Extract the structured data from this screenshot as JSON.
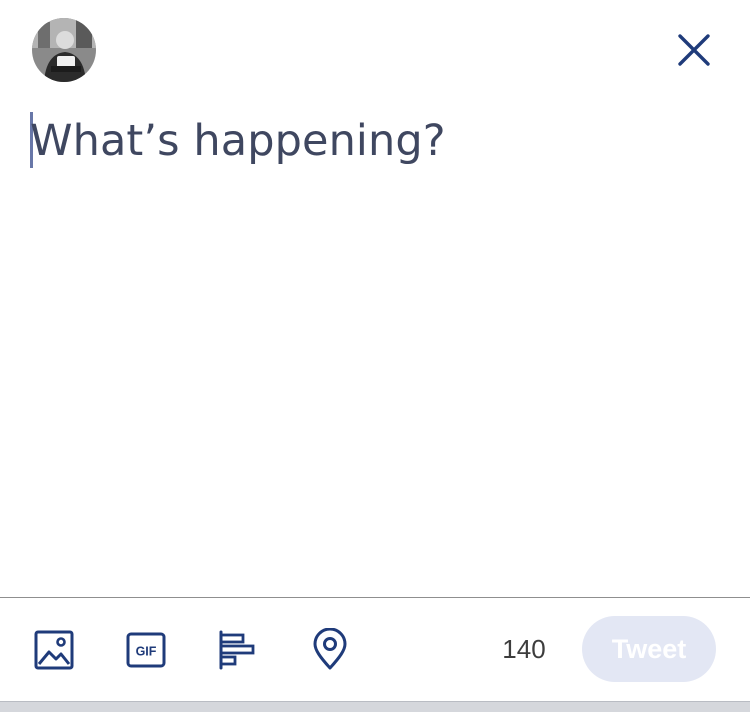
{
  "composer": {
    "placeholder": "What’s happening?"
  },
  "toolbar": {
    "char_count": "140",
    "tweet_label": "Tweet",
    "gif_label": "GIF"
  },
  "icons": {
    "close": "close-icon",
    "photo": "photo-icon",
    "gif": "gif-icon",
    "poll": "poll-icon",
    "location": "location-icon"
  },
  "colors": {
    "accent": "#1f3b7a",
    "tweet_button_disabled": "#e3e7f4",
    "caret": "#6877a8"
  }
}
